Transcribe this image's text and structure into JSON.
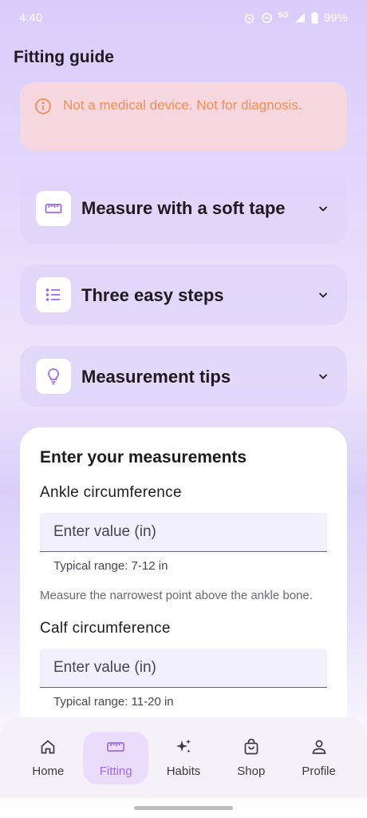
{
  "status_bar": {
    "time": "4:40",
    "network": "5G",
    "battery": "99%",
    "icons": [
      "alarm-icon",
      "dnd-icon",
      "signal-icon",
      "battery-icon"
    ]
  },
  "page": {
    "title": "Fitting guide"
  },
  "warning": {
    "icon": "info-icon",
    "text": "Not a medical device. Not for diagnosis."
  },
  "accordions": [
    {
      "icon": "ruler-icon",
      "label": "Measure with a soft tape"
    },
    {
      "icon": "list-icon",
      "label": "Three easy steps"
    },
    {
      "icon": "lightbulb-icon",
      "label": "Measurement tips"
    }
  ],
  "form": {
    "title": "Enter your measurements",
    "fields": [
      {
        "label": "Ankle circumference",
        "placeholder": "Enter value (in)",
        "hint": "Typical range: 7-12 in",
        "description": "Measure the narrowest point above the ankle bone."
      },
      {
        "label": "Calf circumference",
        "placeholder": "Enter value (in)",
        "hint": "Typical range: 11-20 in"
      }
    ]
  },
  "nav": [
    {
      "label": "Home",
      "icon": "home-icon",
      "active": false
    },
    {
      "label": "Fitting",
      "icon": "ruler-icon",
      "active": true
    },
    {
      "label": "Habits",
      "icon": "sparkle-icon",
      "active": false
    },
    {
      "label": "Shop",
      "icon": "shopping-bag-icon",
      "active": false
    },
    {
      "label": "Profile",
      "icon": "person-icon",
      "active": false
    }
  ],
  "colors": {
    "accent": "#9c68e8",
    "warning_bg": "#f6d7df",
    "warning_text": "#f08f55",
    "nav_active_bg": "#ebdcfc"
  }
}
